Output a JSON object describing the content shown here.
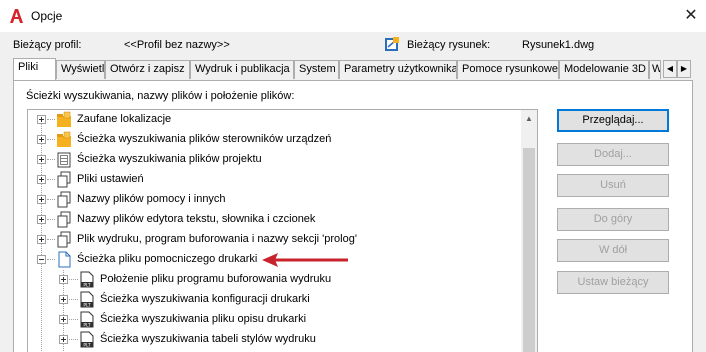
{
  "window": {
    "title": "Opcje",
    "close_glyph": "✕"
  },
  "header": {
    "profile_label": "Bieżący profil:",
    "profile_value": "<<Profil bez nazwy>>",
    "drawing_label": "Bieżący rysunek:",
    "drawing_value": "Rysunek1.dwg"
  },
  "tabs": [
    {
      "label": "Pliki",
      "active": true
    },
    {
      "label": "Wyświetl"
    },
    {
      "label": "Otwórz i zapisz"
    },
    {
      "label": "Wydruk i publikacja"
    },
    {
      "label": "System"
    },
    {
      "label": "Parametry użytkownika"
    },
    {
      "label": "Pomoce rysunkowe"
    },
    {
      "label": "Modelowanie 3D"
    },
    {
      "label": "W"
    }
  ],
  "tab_arrows": {
    "left": "◀",
    "right": "▶"
  },
  "section_label": "Ścieżki wyszukiwania, nazwy plików i położenie plików:",
  "tree": {
    "items": [
      {
        "label": "Zaufane lokalizacje",
        "icon": "folder-lock-icon",
        "expanded": false
      },
      {
        "label": "Ścieżka wyszukiwania plików sterowników urządzeń",
        "icon": "folder-lock-icon",
        "expanded": false
      },
      {
        "label": "Ścieżka wyszukiwania plików projektu",
        "icon": "project-files-icon",
        "expanded": false
      },
      {
        "label": "Pliki ustawień",
        "icon": "files-stack-icon",
        "expanded": false
      },
      {
        "label": "Nazwy plików pomocy i innych",
        "icon": "files-stack-icon",
        "expanded": false
      },
      {
        "label": "Nazwy plików edytora tekstu, słownika i czcionek",
        "icon": "files-stack-icon",
        "expanded": false
      },
      {
        "label": "Plik wydruku, program buforowania i nazwy sekcji 'prolog'",
        "icon": "files-stack-icon",
        "expanded": false
      },
      {
        "label": "Ścieżka pliku pomocniczego drukarki",
        "icon": "document-icon",
        "expanded": true
      },
      {
        "label": "Położenie pliku programu buforowania wydruku",
        "icon": "plt-file-icon",
        "expanded": false,
        "child": true
      },
      {
        "label": "Ścieżka wyszukiwania konfiguracji drukarki",
        "icon": "plt-file-icon",
        "expanded": false,
        "child": true
      },
      {
        "label": "Ścieżka wyszukiwania pliku opisu drukarki",
        "icon": "plt-file-icon",
        "expanded": false,
        "child": true
      },
      {
        "label": "Ścieżka wyszukiwania tabeli stylów wydruku",
        "icon": "plt-file-icon",
        "expanded": false,
        "child": true
      }
    ]
  },
  "buttons": {
    "browse": "Przeglądaj...",
    "add": "Dodaj...",
    "remove": "Usuń",
    "move_up": "Do góry",
    "move_down": "W dół",
    "set_current": "Ustaw bieżący"
  },
  "colors": {
    "accent": "#0078d7",
    "arrow": "#c8232c",
    "folder": "#f5b120"
  }
}
